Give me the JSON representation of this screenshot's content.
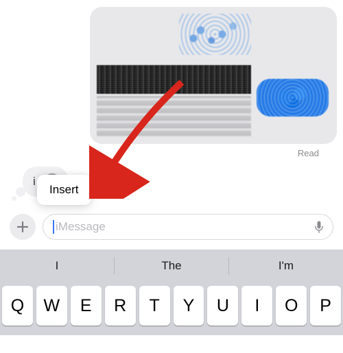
{
  "message": {
    "read_status": "Read"
  },
  "typing": {
    "partial_text": "i"
  },
  "popover": {
    "label": "Insert"
  },
  "input": {
    "placeholder": "iMessage"
  },
  "suggestions": [
    "I",
    "The",
    "I'm"
  ],
  "keys_row1": [
    "Q",
    "W",
    "E",
    "R",
    "T",
    "Y",
    "U",
    "I",
    "O",
    "P"
  ]
}
